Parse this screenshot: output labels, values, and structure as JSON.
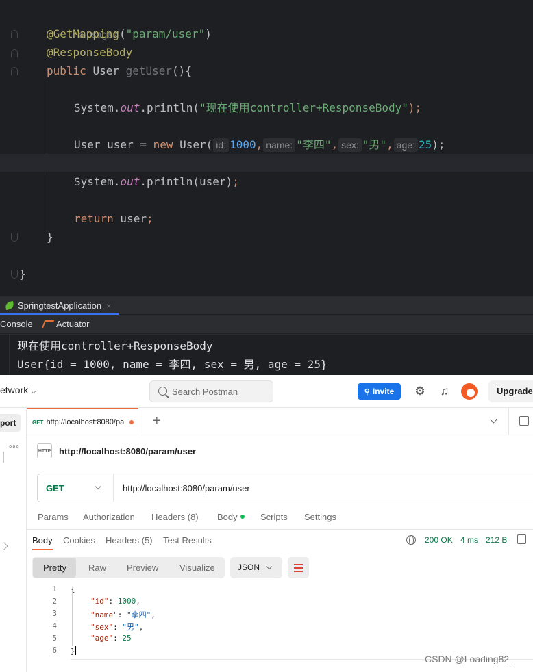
{
  "editor": {
    "usages_hint": "no usages",
    "line_mapping": "@GetMapping",
    "mapping_arg": "\"param/user\"",
    "line_responsebody": "@ResponseBody",
    "kw_public": "public",
    "ret_type": "User",
    "method_name": "getUser",
    "method_tail": "(){",
    "println1_prefix": "System.",
    "println1_out": "out",
    "println1_mid": ".println(",
    "println1_str": "\"现在使用controller+ResponseBody\"",
    "println1_end": ");",
    "user_decl_prefix": "User user = ",
    "kw_new": "new",
    "ctor": " User(",
    "hint_id": "id:",
    "val_id": "1000",
    "hint_name": "name:",
    "val_name": "\"李四\"",
    "hint_sex": "sex:",
    "val_sex": "\"男\"",
    "hint_age": "age:",
    "val_age": "25",
    "user_decl_end": ");",
    "comma": ",",
    "println2_prefix": "System.",
    "println2_out": "out",
    "println2_mid": ".println(user)",
    "println2_end": ";",
    "kw_return": "return",
    "return_val": " user",
    "semicolon": ";",
    "close_method": "}",
    "close_class": "}"
  },
  "run": {
    "app_tab": "SpringtestApplication",
    "close_glyph": "×",
    "console_tab": "Console",
    "actuator_tab": "Actuator",
    "output": [
      "现在使用controller+ResponseBody",
      "User{id = 1000, name = 李四, sex = 男, age = 25}"
    ]
  },
  "postman": {
    "workspace": "etwork",
    "search_placeholder": "Search Postman",
    "invite_label": "Invite",
    "upgrade_label": "Upgrade",
    "import_label": "port",
    "more_glyph": "∘∘∘",
    "tab_method": "GET",
    "tab_url": "http://localhost:8080/pa",
    "plus_glyph": "+",
    "request_title": "http://localhost:8080/param/user",
    "http_badge": "HTTP",
    "method": "GET",
    "url": "http://localhost:8080/param/user",
    "request_tabs": {
      "params": "Params",
      "authorization": "Authorization",
      "headers": "Headers (8)",
      "body": "Body",
      "scripts": "Scripts",
      "settings": "Settings"
    },
    "response_tabs": {
      "body": "Body",
      "cookies": "Cookies",
      "headers": "Headers (5)",
      "test_results": "Test Results"
    },
    "status": "200 OK",
    "time": "4 ms",
    "size": "212 B",
    "format_options": {
      "pretty": "Pretty",
      "raw": "Raw",
      "preview": "Preview",
      "visualize": "Visualize"
    },
    "format_select": "JSON",
    "line_numbers": [
      "1",
      "2",
      "3",
      "4",
      "5",
      "6"
    ],
    "json": {
      "open": "{",
      "id_key": "\"id\"",
      "id_val": "1000",
      "name_key": "\"name\"",
      "name_val": "\"李四\"",
      "sex_key": "\"sex\"",
      "sex_val": "\"男\"",
      "age_key": "\"age\"",
      "age_val": "25",
      "close": "}",
      "colon": ": ",
      "comma": ","
    },
    "colors": {
      "accent": "#f26b3a",
      "invite": "#1a73e8",
      "get_method": "#0a7a4a"
    }
  },
  "watermark": "CSDN @Loading82_"
}
